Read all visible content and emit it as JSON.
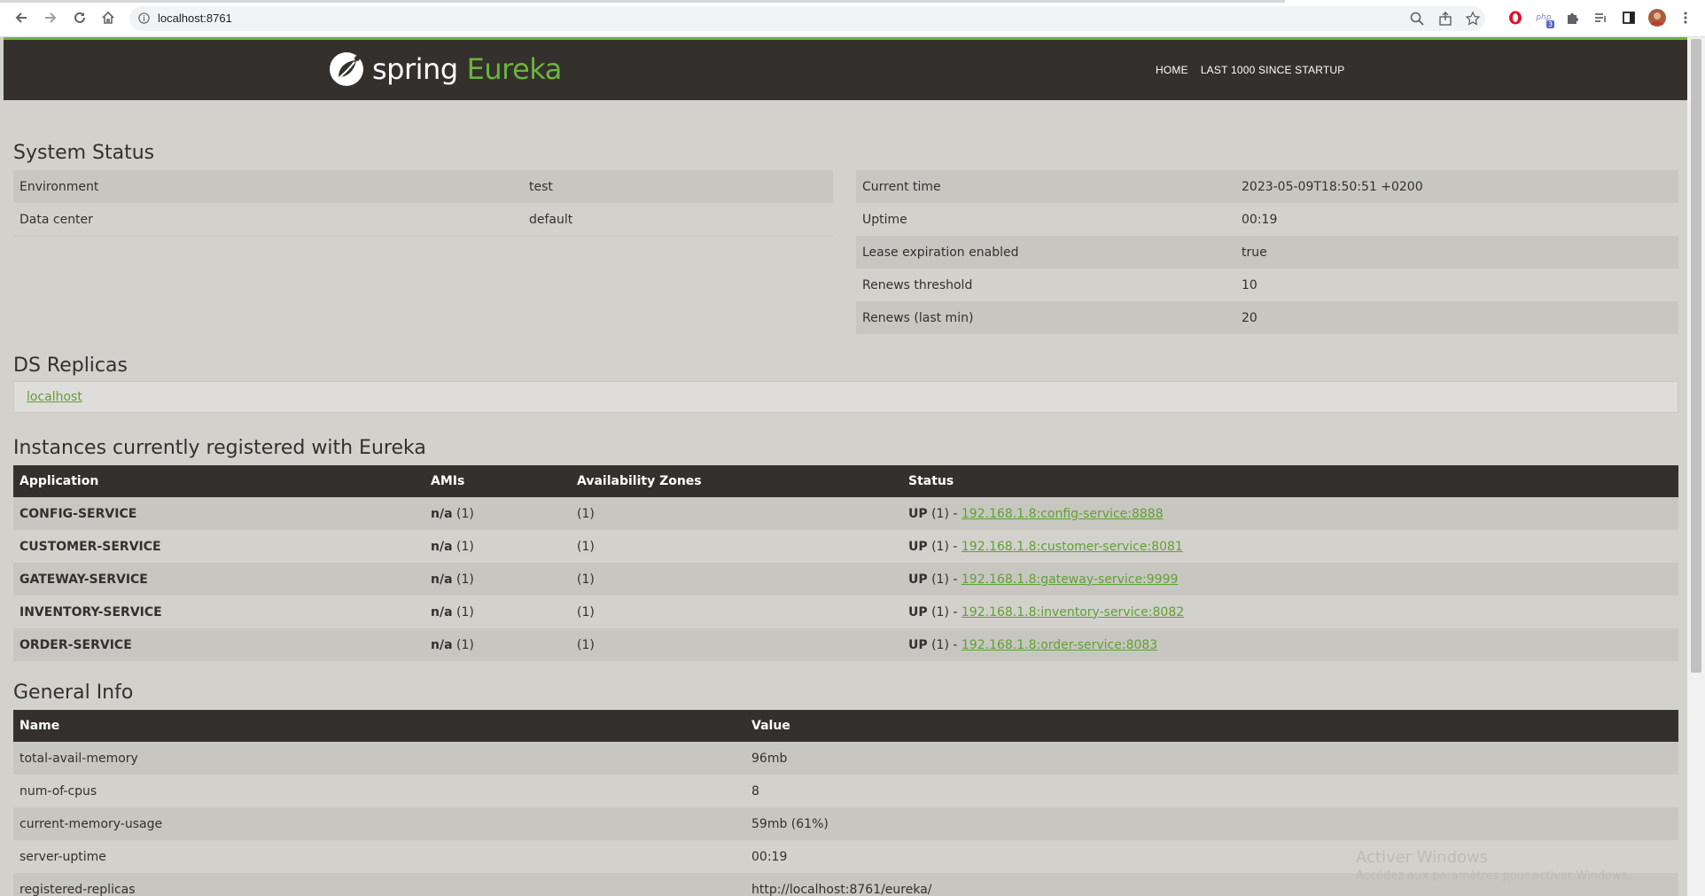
{
  "browser": {
    "url": "localhost:8761",
    "ext_badge": "3",
    "ext_php": "php"
  },
  "header": {
    "brand_spring": "spring",
    "brand_eureka": "Eureka",
    "nav": [
      "HOME",
      "LAST 1000 SINCE STARTUP"
    ]
  },
  "system_status": {
    "title": "System Status",
    "left": [
      {
        "label": "Environment",
        "value": "test"
      },
      {
        "label": "Data center",
        "value": "default"
      }
    ],
    "right": [
      {
        "label": "Current time",
        "value": "2023-05-09T18:50:51 +0200"
      },
      {
        "label": "Uptime",
        "value": "00:19"
      },
      {
        "label": "Lease expiration enabled",
        "value": "true"
      },
      {
        "label": "Renews threshold",
        "value": "10"
      },
      {
        "label": "Renews (last min)",
        "value": "20"
      }
    ]
  },
  "ds_replicas": {
    "title": "DS Replicas",
    "link": "localhost"
  },
  "instances": {
    "title": "Instances currently registered with Eureka",
    "headers": [
      "Application",
      "AMIs",
      "Availability Zones",
      "Status"
    ],
    "rows": [
      {
        "app": "CONFIG-SERVICE",
        "ami": "n/a",
        "ami_count": "(1)",
        "zones": "(1)",
        "status": "UP",
        "status_count": "(1) -",
        "link": "192.168.1.8:config-service:8888"
      },
      {
        "app": "CUSTOMER-SERVICE",
        "ami": "n/a",
        "ami_count": "(1)",
        "zones": "(1)",
        "status": "UP",
        "status_count": "(1) -",
        "link": "192.168.1.8:customer-service:8081"
      },
      {
        "app": "GATEWAY-SERVICE",
        "ami": "n/a",
        "ami_count": "(1)",
        "zones": "(1)",
        "status": "UP",
        "status_count": "(1) -",
        "link": "192.168.1.8:gateway-service:9999"
      },
      {
        "app": "INVENTORY-SERVICE",
        "ami": "n/a",
        "ami_count": "(1)",
        "zones": "(1)",
        "status": "UP",
        "status_count": "(1) -",
        "link": "192.168.1.8:inventory-service:8082"
      },
      {
        "app": "ORDER-SERVICE",
        "ami": "n/a",
        "ami_count": "(1)",
        "zones": "(1)",
        "status": "UP",
        "status_count": "(1) -",
        "link": "192.168.1.8:order-service:8083"
      }
    ]
  },
  "general_info": {
    "title": "General Info",
    "headers": [
      "Name",
      "Value"
    ],
    "rows": [
      {
        "name": "total-avail-memory",
        "value": "96mb"
      },
      {
        "name": "num-of-cpus",
        "value": "8"
      },
      {
        "name": "current-memory-usage",
        "value": "59mb (61%)"
      },
      {
        "name": "server-uptime",
        "value": "00:19"
      },
      {
        "name": "registered-replicas",
        "value": "http://localhost:8761/eureka/"
      }
    ]
  },
  "watermark": {
    "line1": "Activer Windows",
    "line2": "Accédez aux paramètres pour activer Windows."
  }
}
